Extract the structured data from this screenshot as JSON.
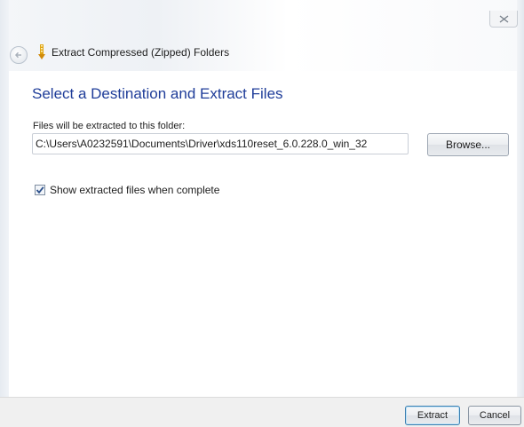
{
  "window": {
    "title": "Extract Compressed (Zipped) Folders"
  },
  "icons": {
    "close": "close-icon",
    "back": "back-arrow-icon",
    "zip": "zip-folder-icon",
    "check": "checkmark-icon"
  },
  "content": {
    "heading": "Select a Destination and Extract Files",
    "path_label": "Files will be extracted to this folder:",
    "path_value": "C:\\Users\\A0232591\\Documents\\Driver\\xds110reset_6.0.228.0_win_32",
    "browse_label": "Browse...",
    "show_files_label": "Show extracted files when complete",
    "show_files_checked": true
  },
  "footer": {
    "extract_label": "Extract",
    "cancel_label": "Cancel"
  },
  "colors": {
    "heading": "#1f3d99",
    "footer_bg": "#f0f0f0"
  }
}
